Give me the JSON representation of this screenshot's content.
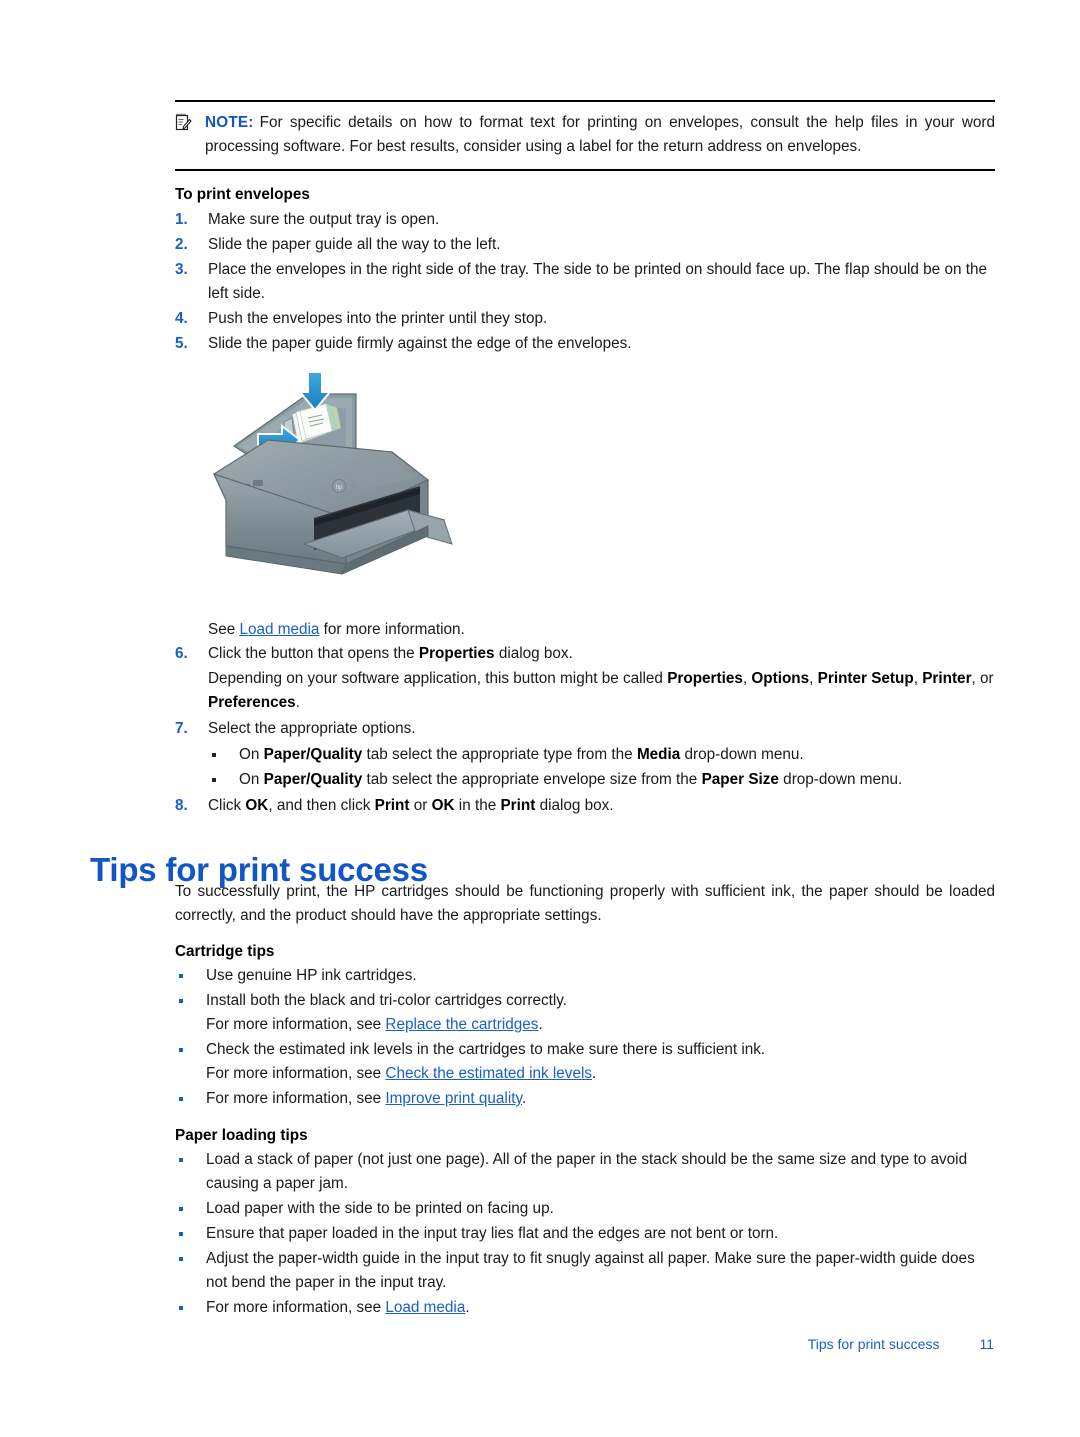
{
  "note": {
    "icon": "note-pad-pencil-icon",
    "label": "NOTE:",
    "text": "For specific details on how to format text for printing on envelopes, consult the help files in your word processing software. For best results, consider using a label for the return address on envelopes."
  },
  "envelopes_section": {
    "heading": "To print envelopes",
    "steps": [
      {
        "num": "1.",
        "text": "Make sure the output tray is open."
      },
      {
        "num": "2.",
        "text": "Slide the paper guide all the way to the left."
      },
      {
        "num": "3.",
        "text": "Place the envelopes in the right side of the tray. The side to be printed on should face up. The flap should be on the left side."
      },
      {
        "num": "4.",
        "text": "Push the envelopes into the printer until they stop."
      },
      {
        "num": "5.",
        "text": "Slide the paper guide firmly against the edge of the envelopes."
      }
    ],
    "see_more": {
      "prefix": "See ",
      "link": "Load media",
      "suffix": " for more information."
    },
    "steps_after": {
      "step6": {
        "num": "6.",
        "lead_a": "Click the button that opens the ",
        "lead_bold": "Properties",
        "lead_b": " dialog box.",
        "detail_a": "Depending on your software application, this button might be called ",
        "bold1": "Properties",
        "detail_b": ", ",
        "bold2": "Options",
        "detail_c": ", ",
        "bold3": "Printer Setup",
        "detail_d": ", ",
        "bold4": "Printer",
        "detail_e": ", or ",
        "bold5": "Preferences",
        "detail_f": "."
      },
      "step7": {
        "num": "7.",
        "text": "Select the appropriate options.",
        "bullets": [
          {
            "a": "On ",
            "b1": "Paper/Quality",
            "b": " tab select the appropriate type from the ",
            "b2": "Media",
            "c": " drop-down menu."
          },
          {
            "a": "On ",
            "b1": "Paper/Quality",
            "b": " tab select the appropriate envelope size from the ",
            "b2": "Paper Size",
            "c": " drop-down menu."
          }
        ]
      },
      "step8": {
        "num": "8.",
        "a": "Click ",
        "b1": "OK",
        "b": ", and then click ",
        "b2": "Print",
        "c": " or ",
        "b3": "OK",
        "d": " in the ",
        "b4": "Print",
        "e": " dialog box."
      }
    }
  },
  "tips_section": {
    "title": "Tips for print success",
    "intro": "To successfully print, the HP cartridges should be functioning properly with sufficient ink, the paper should be loaded correctly, and the product should have the appropriate settings.",
    "cartridge": {
      "heading": "Cartridge tips",
      "items": [
        {
          "text": "Use genuine HP ink cartridges."
        },
        {
          "text": "Install both the black and tri-color cartridges correctly.",
          "sub_prefix": "For more information, see ",
          "sub_link": "Replace the cartridges",
          "sub_suffix": "."
        },
        {
          "text": "Check the estimated ink levels in the cartridges to make sure there is sufficient ink.",
          "sub_prefix": "For more information, see ",
          "sub_link": "Check the estimated ink levels",
          "sub_suffix": "."
        },
        {
          "inline_prefix": "For more information, see ",
          "inline_link": "Improve print quality",
          "inline_suffix": "."
        }
      ]
    },
    "paper": {
      "heading": "Paper loading tips",
      "items": [
        {
          "text": "Load a stack of paper (not just one page). All of the paper in the stack should be the same size and type to avoid causing a paper jam."
        },
        {
          "text": "Load paper with the side to be printed on facing up."
        },
        {
          "text": "Ensure that paper loaded in the input tray lies flat and the edges are not bent or torn."
        },
        {
          "text": "Adjust the paper-width guide in the input tray to fit snugly against all paper. Make sure the paper-width guide does not bend the paper in the input tray."
        },
        {
          "inline_prefix": "For more information, see ",
          "inline_link": "Load media",
          "inline_suffix": "."
        }
      ]
    }
  },
  "illustration": {
    "name": "hp-deskjet-printer-loading-envelopes-illustration",
    "description": "HP Deskjet all-in-one printer with envelopes loaded in the input tray, a blue downward arrow into the tray and a blue rightward arrow for the paper guide"
  },
  "footer": {
    "title": "Tips for print success",
    "page_number": "11"
  },
  "colors": {
    "heading_blue": "#1255c4",
    "link_blue": "#1a5fc8",
    "body_text": "#1a1a1a",
    "rule_black": "#000000"
  }
}
